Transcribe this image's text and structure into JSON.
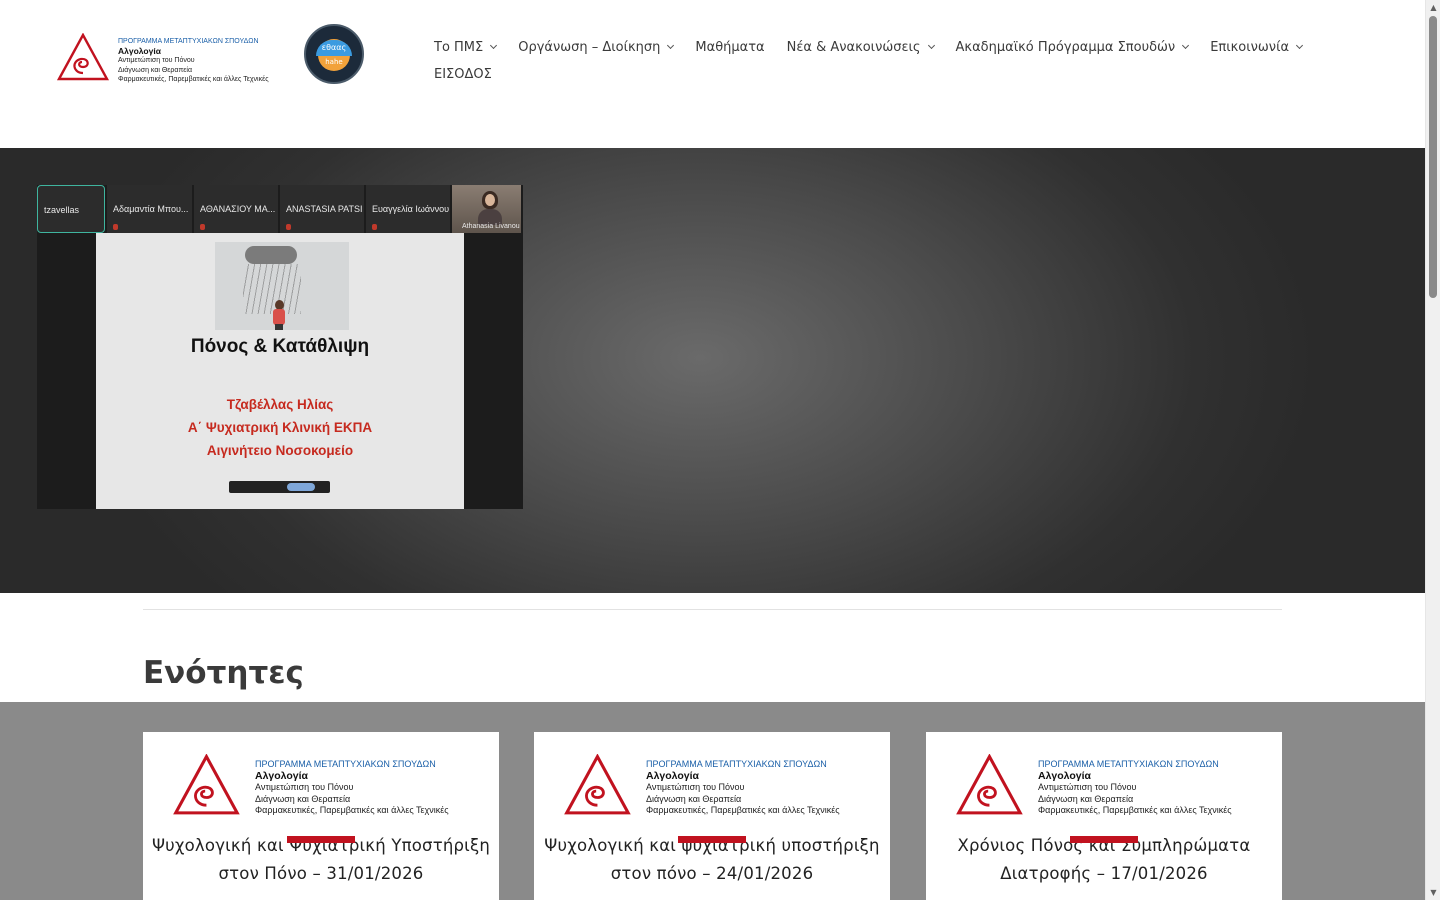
{
  "header": {
    "logo": {
      "line1": "ΠΡΟΓΡΑΜΜΑ ΜΕΤΑΠΤΥΧΙΑΚΩΝ ΣΠΟΥΔΩΝ",
      "line2": "Αλγολογία",
      "line3": "Αντιμετώπιση του Πόνου",
      "line4": "Διάγνωση και Θεραπεία",
      "line5": "Φαρμακευτικές, Παρεμβατικές και άλλες Τεχνικές"
    },
    "badge": {
      "text_top": "εθαας",
      "text_bottom": "hahe"
    },
    "nav": [
      {
        "label": "Το ΠΜΣ",
        "has_dropdown": true
      },
      {
        "label": "Οργάνωση – Διοίκηση",
        "has_dropdown": true
      },
      {
        "label": "Μαθήματα",
        "has_dropdown": false
      },
      {
        "label": "Νέα & Ανακοινώσεις",
        "has_dropdown": true
      },
      {
        "label": "Ακαδημαϊκό Πρόγραμμα Σπουδών",
        "has_dropdown": true
      },
      {
        "label": "Επικοινωνία",
        "has_dropdown": true
      }
    ],
    "nav_row2": "ΕΙΣΟΔΟΣ"
  },
  "hero": {
    "participants": [
      "tzavellas",
      "Αδαμαντία Μπου...",
      "ΑΘΑΝΑΣΙΟΥ ΜΑ...",
      "ANASTASIA PATSI",
      "Ευαγγελία Ιωάννου",
      "Athanasia Livanou"
    ],
    "slide": {
      "title": "Πόνος & Κατάθλιψη",
      "lines": [
        "Τζαβέλλας Ηλίας",
        "Α΄ Ψυχιατρική Κλινική ΕΚΠΑ",
        "Αιγινήτειο Νοσοκομείο"
      ]
    }
  },
  "section": {
    "title": "Ενότητες"
  },
  "cards": [
    {
      "title_line1": "Ψυχολογική και Ψυχιατρική Υποστήριξη",
      "title_line2": "στον Πόνο – 31/01/2026"
    },
    {
      "title_line1": "Ψυχολογική και ψυχιατρική υποστήριξη",
      "title_line2": "στον πόνο – 24/01/2026"
    },
    {
      "title_line1": "Χρόνιος Πόνος και Συμπληρώματα",
      "title_line2": "Διατροφής – 17/01/2026"
    }
  ],
  "colors": {
    "accent_red": "#c1121f",
    "logo_blue": "#1a5fa8",
    "hero_dark": "#2a2a2a",
    "cards_band": "#8a8a8a"
  }
}
